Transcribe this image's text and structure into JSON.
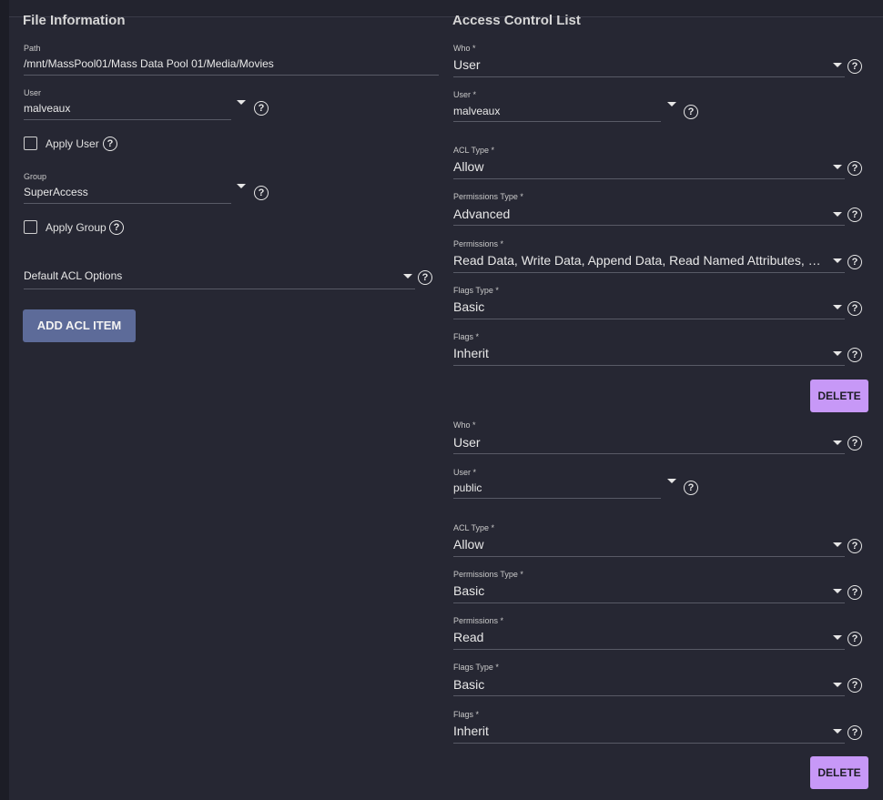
{
  "file_info": {
    "heading": "File Information",
    "path": {
      "label": "Path",
      "value": "/mnt/MassPool01/Mass Data Pool 01/Media/Movies"
    },
    "user": {
      "label": "User",
      "value": "malveaux"
    },
    "apply_user": {
      "label": "Apply User",
      "checked": false
    },
    "group": {
      "label": "Group",
      "value": "SuperAccess"
    },
    "apply_group": {
      "label": "Apply Group",
      "checked": false
    },
    "default_acl": {
      "label": "Default ACL Options"
    },
    "add_button": "ADD ACL ITEM"
  },
  "acl": {
    "heading": "Access Control List",
    "items": [
      {
        "who": {
          "label": "Who *",
          "value": "User"
        },
        "user": {
          "label": "User *",
          "value": "malveaux"
        },
        "acl_type": {
          "label": "ACL Type *",
          "value": "Allow"
        },
        "permissions_type": {
          "label": "Permissions Type *",
          "value": "Advanced"
        },
        "permissions": {
          "label": "Permissions *",
          "value": "Read Data, Write Data, Append Data, Read Named Attributes, Write Named Attributes"
        },
        "flags_type": {
          "label": "Flags Type *",
          "value": "Basic"
        },
        "flags": {
          "label": "Flags *",
          "value": "Inherit"
        },
        "delete": "DELETE"
      },
      {
        "who": {
          "label": "Who *",
          "value": "User"
        },
        "user": {
          "label": "User *",
          "value": "public"
        },
        "acl_type": {
          "label": "ACL Type *",
          "value": "Allow"
        },
        "permissions_type": {
          "label": "Permissions Type *",
          "value": "Basic"
        },
        "permissions": {
          "label": "Permissions *",
          "value": "Read"
        },
        "flags_type": {
          "label": "Flags Type *",
          "value": "Basic"
        },
        "flags": {
          "label": "Flags *",
          "value": "Inherit"
        },
        "delete": "DELETE"
      }
    ]
  },
  "icons": {
    "help": "help-circle-icon",
    "dropdown": "caret-down-icon",
    "checkbox": "checkbox-icon"
  }
}
